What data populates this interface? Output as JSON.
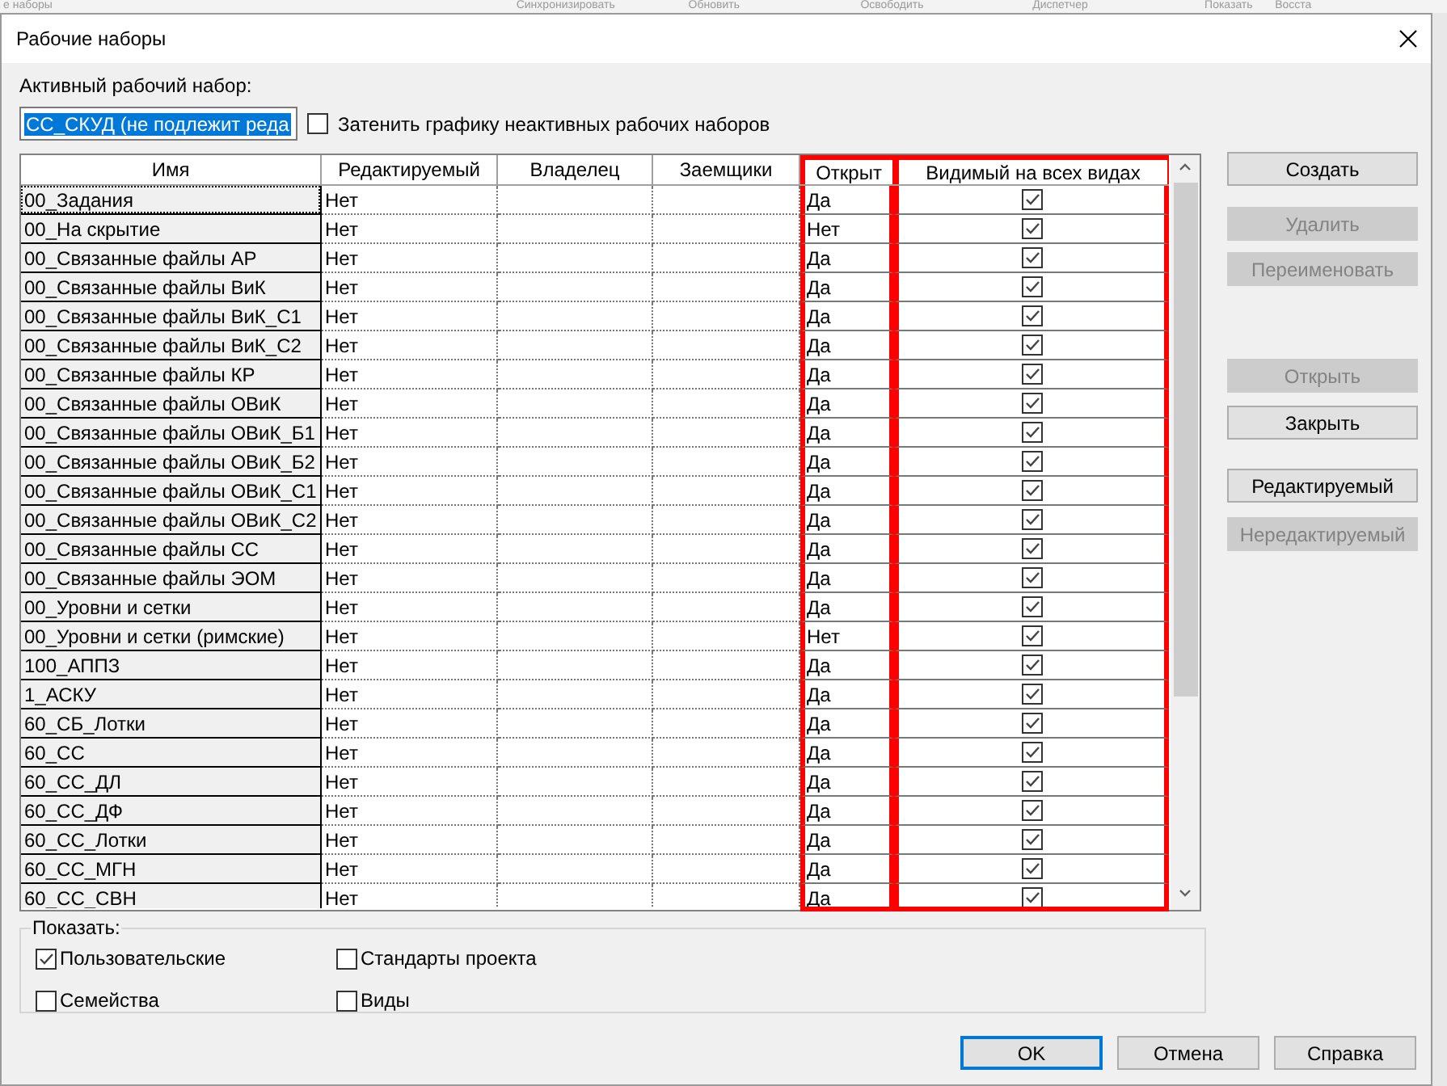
{
  "background_toolbar": [
    "е наборы",
    "Синхронизировать",
    "Обновить",
    "Освободить",
    "Диспетчер",
    "Показать",
    "Восста"
  ],
  "window": {
    "title": "Рабочие наборы"
  },
  "active_set": {
    "label": "Активный рабочий набор:",
    "value": "СС_СКУД (не подлежит реда"
  },
  "gray_inactive": {
    "label": "Затенить графику неактивных рабочих наборов",
    "checked": false
  },
  "table": {
    "columns": [
      {
        "label": "Имя",
        "highlighted": false
      },
      {
        "label": "Редактируемый",
        "highlighted": false
      },
      {
        "label": "Владелец",
        "highlighted": false
      },
      {
        "label": "Заемщики",
        "highlighted": false
      },
      {
        "label": "Открыт",
        "highlighted": true
      },
      {
        "label": "Видимый на всех видах",
        "highlighted": true
      }
    ],
    "rows": [
      {
        "name": "00_Задания",
        "editable": "Нет",
        "open": "Да",
        "visible": true,
        "focused": true
      },
      {
        "name": "00_На скрытие",
        "editable": "Нет",
        "open": "Нет",
        "visible": true,
        "focused": false
      },
      {
        "name": "00_Связанные файлы АР",
        "editable": "Нет",
        "open": "Да",
        "visible": true,
        "focused": false
      },
      {
        "name": "00_Связанные файлы ВиК",
        "editable": "Нет",
        "open": "Да",
        "visible": true,
        "focused": false
      },
      {
        "name": "00_Связанные файлы ВиК_С1",
        "editable": "Нет",
        "open": "Да",
        "visible": true,
        "focused": false
      },
      {
        "name": "00_Связанные файлы ВиК_С2",
        "editable": "Нет",
        "open": "Да",
        "visible": true,
        "focused": false
      },
      {
        "name": "00_Связанные файлы КР",
        "editable": "Нет",
        "open": "Да",
        "visible": true,
        "focused": false
      },
      {
        "name": "00_Связанные файлы ОВиК",
        "editable": "Нет",
        "open": "Да",
        "visible": true,
        "focused": false
      },
      {
        "name": "00_Связанные файлы ОВиК_Б1",
        "editable": "Нет",
        "open": "Да",
        "visible": true,
        "focused": false
      },
      {
        "name": "00_Связанные файлы ОВиК_Б2",
        "editable": "Нет",
        "open": "Да",
        "visible": true,
        "focused": false
      },
      {
        "name": "00_Связанные файлы ОВиК_С1",
        "editable": "Нет",
        "open": "Да",
        "visible": true,
        "focused": false
      },
      {
        "name": "00_Связанные файлы ОВиК_С2",
        "editable": "Нет",
        "open": "Да",
        "visible": true,
        "focused": false
      },
      {
        "name": "00_Связанные файлы СС",
        "editable": "Нет",
        "open": "Да",
        "visible": true,
        "focused": false
      },
      {
        "name": "00_Связанные файлы ЭОМ",
        "editable": "Нет",
        "open": "Да",
        "visible": true,
        "focused": false
      },
      {
        "name": "00_Уровни и сетки",
        "editable": "Нет",
        "open": "Да",
        "visible": true,
        "focused": false
      },
      {
        "name": "00_Уровни и сетки (римские)",
        "editable": "Нет",
        "open": "Нет",
        "visible": true,
        "focused": false
      },
      {
        "name": "100_АППЗ",
        "editable": "Нет",
        "open": "Да",
        "visible": true,
        "focused": false
      },
      {
        "name": "1_АСКУ",
        "editable": "Нет",
        "open": "Да",
        "visible": true,
        "focused": false
      },
      {
        "name": "60_СБ_Лотки",
        "editable": "Нет",
        "open": "Да",
        "visible": true,
        "focused": false
      },
      {
        "name": "60_СС",
        "editable": "Нет",
        "open": "Да",
        "visible": true,
        "focused": false
      },
      {
        "name": "60_СС_ДЛ",
        "editable": "Нет",
        "open": "Да",
        "visible": true,
        "focused": false
      },
      {
        "name": "60_СС_ДФ",
        "editable": "Нет",
        "open": "Да",
        "visible": true,
        "focused": false
      },
      {
        "name": "60_СС_Лотки",
        "editable": "Нет",
        "open": "Да",
        "visible": true,
        "focused": false
      },
      {
        "name": "60_СС_МГН",
        "editable": "Нет",
        "open": "Да",
        "visible": true,
        "focused": false
      },
      {
        "name": "60_СС_СВН",
        "editable": "Нет",
        "open": "Да",
        "visible": true,
        "focused": false
      }
    ]
  },
  "side_buttons": [
    {
      "label": "Создать",
      "disabled": false
    },
    {
      "label": "Удалить",
      "disabled": true
    },
    {
      "label": "Переименовать",
      "disabled": true
    },
    {
      "label": "Открыть",
      "disabled": true
    },
    {
      "label": "Закрыть",
      "disabled": false
    },
    {
      "label": "Редактируемый",
      "disabled": false
    },
    {
      "label": "Нередактируемый",
      "disabled": true
    }
  ],
  "show": {
    "label": "Показать:",
    "options": [
      {
        "label": "Пользовательские",
        "checked": true
      },
      {
        "label": "Стандарты проекта",
        "checked": false
      },
      {
        "label": "Семейства",
        "checked": false
      },
      {
        "label": "Виды",
        "checked": false
      }
    ]
  },
  "footer_buttons": [
    {
      "label": "OK",
      "default": true
    },
    {
      "label": "Отмена",
      "default": false
    },
    {
      "label": "Справка",
      "default": false
    }
  ]
}
